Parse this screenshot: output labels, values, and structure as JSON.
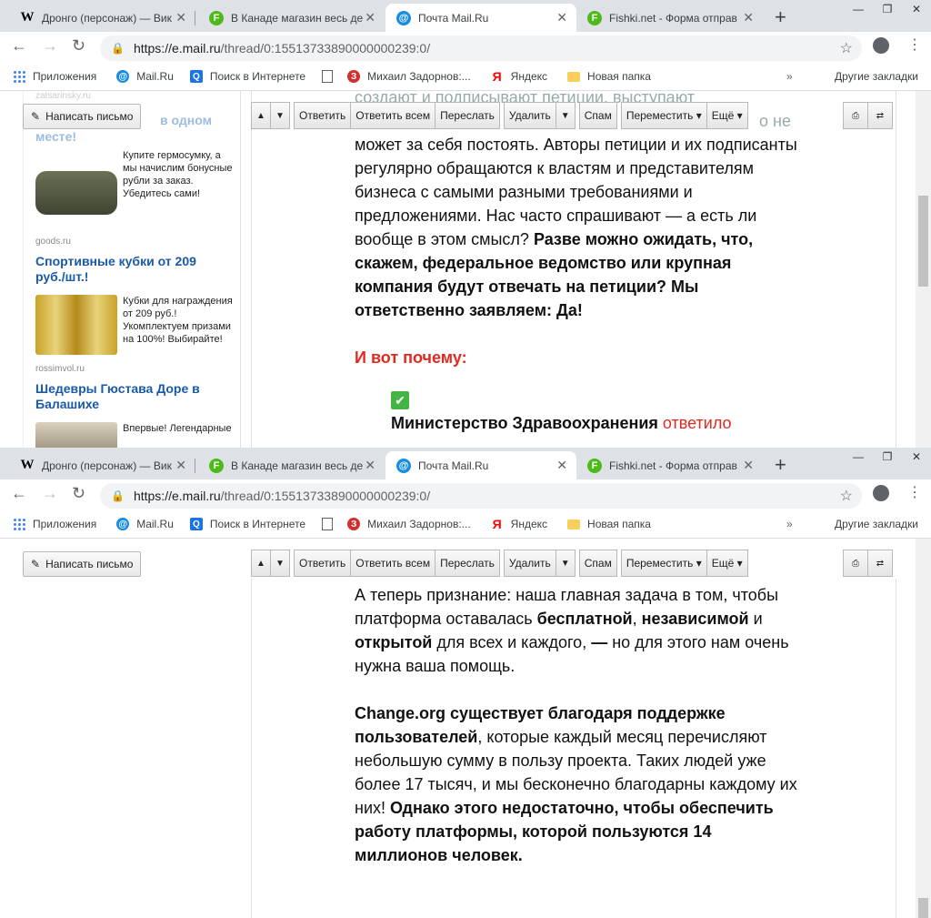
{
  "browser": {
    "tabs": [
      {
        "title": "Дронго (персонаж) — Вик",
        "icon": "W"
      },
      {
        "title": "В Канаде магазин весь де",
        "icon": "F"
      },
      {
        "title": "Почта Mail.Ru",
        "icon": "@"
      },
      {
        "title": "Fishki.net - Форма отправ",
        "icon": "F"
      }
    ],
    "url_host": "https://e.mail.ru",
    "url_path": "/thread/0:15513733890000000239:0/",
    "bookmarks": [
      {
        "label": "Приложения",
        "icon": "apps-grid-icon"
      },
      {
        "label": "Mail.Ru",
        "icon": "mailru-icon"
      },
      {
        "label": "Поиск в Интернете",
        "icon": "search-icon"
      },
      {
        "label": "",
        "icon": "page-icon"
      },
      {
        "label": "Михаил Задорнов:...",
        "icon": "zadornov-icon"
      },
      {
        "label": "Яндекс",
        "icon": "yandex-icon"
      },
      {
        "label": "Новая папка",
        "icon": "folder-icon"
      }
    ],
    "other_bookmarks": "Другие закладки"
  },
  "mail": {
    "compose_label": "Написать письмо",
    "toolbar": {
      "reply": "Ответить",
      "reply_all": "Ответить всем",
      "forward": "Переслать",
      "delete": "Удалить",
      "spam": "Спам",
      "move": "Переместить",
      "more": "Ещё"
    }
  },
  "ads": [
    {
      "domain": "zatsarinsky.ru",
      "title_tail": "в одном",
      "title_end": "месте!",
      "desc": "Купите гермосумку, а мы начислим бонусные рубли за заказ. Убедитесь сами!"
    },
    {
      "domain": "goods.ru",
      "title": "Спортивные кубки от 209 руб./шт.!",
      "desc": "Кубки для награждения от 209 руб.! Укомплектуем призами на 100%! Выбирайте!"
    },
    {
      "domain": "rossimvol.ru",
      "title": "Шедевры Гюстава Доре в Балашихе",
      "desc": "Впервые! Легендарные"
    }
  ],
  "message_top": {
    "ghost1": "создают и подписывают петиции, выступают",
    "ghost2": "о не",
    "p1": "может за себя постоять. Авторы петиции и их подписанты регулярно обращаются к властям и представителям бизнеса с самыми разными требованиями и предложениями. Нас часто спрашивают — а есть ли вообще в этом смысл?",
    "p1_bold": "Разве можно ожидать, что, скажем, федеральное ведомство или крупная компания будут отвечать на петиции? Мы ответственно заявляем: Да!",
    "heading": "И вот почему:",
    "item_bold": "Министерство Здравоохранения",
    "item_red": "ответило"
  },
  "message_bottom": {
    "a1": "А теперь признание: наша главная задача в том, чтобы платформа оставалась ",
    "a_b1": "бесплатной",
    "a2": ", ",
    "a_b2": "независимой",
    "a3": " и ",
    "a_b3": "открытой",
    "a4": " для всех и каждого, ",
    "a_dash": "—",
    "a5": " но для этого нам очень нужна ваша помощь.",
    "b_b1": "Change.org существует благодаря поддержке пользователей",
    "b1": ", которые каждый месяц перечисляют небольшую сумму в пользу проекта. Таких людей уже более 17 тысяч, и мы бесконечно благодарны каждому их них! ",
    "b_b2": "Однако этого недостаточно, чтобы обеспечить работу платформы, которой пользуются 14 миллионов человек."
  }
}
